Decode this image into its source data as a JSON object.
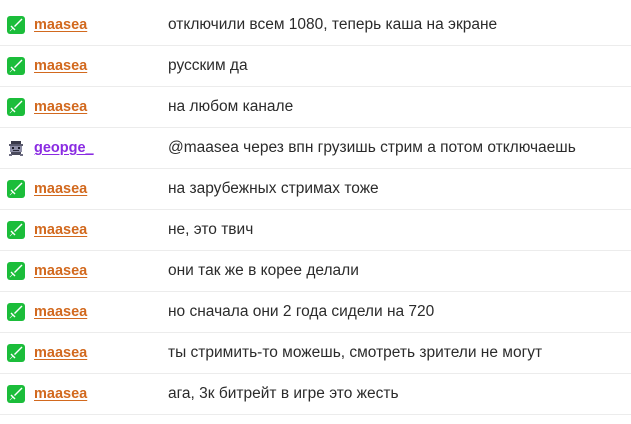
{
  "colors": {
    "maasea": "#d2691e",
    "geopge": "#8a2be2",
    "badge_green": "#1bbd3a"
  },
  "messages": [
    {
      "user": "maasea",
      "text": "отключили всем 1080, теперь каша на экране",
      "badge": "sword-badge-icon"
    },
    {
      "user": "maasea",
      "text": "русским да",
      "badge": "sword-badge-icon"
    },
    {
      "user": "maasea",
      "text": "на любом канале",
      "badge": "sword-badge-icon"
    },
    {
      "user": "geopge_",
      "text": "@maasea через впн грузишь стрим а потом отключаешь",
      "badge": "pixel-avatar-icon"
    },
    {
      "user": "maasea",
      "text": "на зарубежных стримах тоже",
      "badge": "sword-badge-icon"
    },
    {
      "user": "maasea",
      "text": "не, это твич",
      "badge": "sword-badge-icon"
    },
    {
      "user": "maasea",
      "text": "они так же в корее делали",
      "badge": "sword-badge-icon"
    },
    {
      "user": "maasea",
      "text": "но сначала они 2 года сидели на 720",
      "badge": "sword-badge-icon"
    },
    {
      "user": "maasea",
      "text": "ты стримить-то можешь, смотреть зрители не могут",
      "badge": "sword-badge-icon"
    },
    {
      "user": "maasea",
      "text": "ага, 3к битрейт в игре это жесть",
      "badge": "sword-badge-icon"
    }
  ]
}
